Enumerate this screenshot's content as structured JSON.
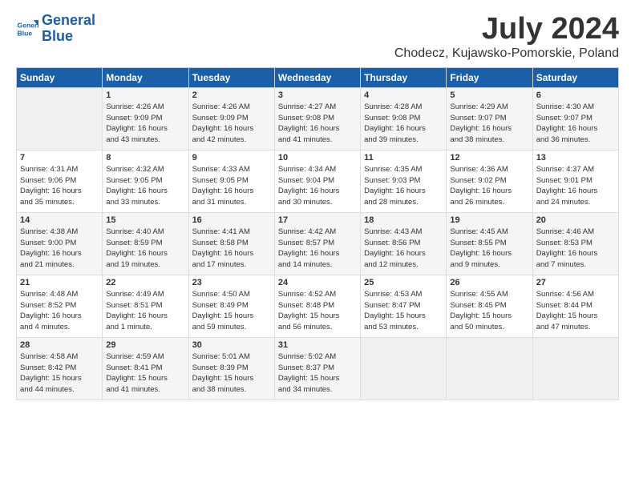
{
  "header": {
    "logo_line1": "General",
    "logo_line2": "Blue",
    "month": "July 2024",
    "location": "Chodecz, Kujawsko-Pomorskie, Poland"
  },
  "days_of_week": [
    "Sunday",
    "Monday",
    "Tuesday",
    "Wednesday",
    "Thursday",
    "Friday",
    "Saturday"
  ],
  "weeks": [
    [
      {
        "day": "",
        "data": ""
      },
      {
        "day": "1",
        "data": "Sunrise: 4:26 AM\nSunset: 9:09 PM\nDaylight: 16 hours\nand 43 minutes."
      },
      {
        "day": "2",
        "data": "Sunrise: 4:26 AM\nSunset: 9:09 PM\nDaylight: 16 hours\nand 42 minutes."
      },
      {
        "day": "3",
        "data": "Sunrise: 4:27 AM\nSunset: 9:08 PM\nDaylight: 16 hours\nand 41 minutes."
      },
      {
        "day": "4",
        "data": "Sunrise: 4:28 AM\nSunset: 9:08 PM\nDaylight: 16 hours\nand 39 minutes."
      },
      {
        "day": "5",
        "data": "Sunrise: 4:29 AM\nSunset: 9:07 PM\nDaylight: 16 hours\nand 38 minutes."
      },
      {
        "day": "6",
        "data": "Sunrise: 4:30 AM\nSunset: 9:07 PM\nDaylight: 16 hours\nand 36 minutes."
      }
    ],
    [
      {
        "day": "7",
        "data": "Sunrise: 4:31 AM\nSunset: 9:06 PM\nDaylight: 16 hours\nand 35 minutes."
      },
      {
        "day": "8",
        "data": "Sunrise: 4:32 AM\nSunset: 9:05 PM\nDaylight: 16 hours\nand 33 minutes."
      },
      {
        "day": "9",
        "data": "Sunrise: 4:33 AM\nSunset: 9:05 PM\nDaylight: 16 hours\nand 31 minutes."
      },
      {
        "day": "10",
        "data": "Sunrise: 4:34 AM\nSunset: 9:04 PM\nDaylight: 16 hours\nand 30 minutes."
      },
      {
        "day": "11",
        "data": "Sunrise: 4:35 AM\nSunset: 9:03 PM\nDaylight: 16 hours\nand 28 minutes."
      },
      {
        "day": "12",
        "data": "Sunrise: 4:36 AM\nSunset: 9:02 PM\nDaylight: 16 hours\nand 26 minutes."
      },
      {
        "day": "13",
        "data": "Sunrise: 4:37 AM\nSunset: 9:01 PM\nDaylight: 16 hours\nand 24 minutes."
      }
    ],
    [
      {
        "day": "14",
        "data": "Sunrise: 4:38 AM\nSunset: 9:00 PM\nDaylight: 16 hours\nand 21 minutes."
      },
      {
        "day": "15",
        "data": "Sunrise: 4:40 AM\nSunset: 8:59 PM\nDaylight: 16 hours\nand 19 minutes."
      },
      {
        "day": "16",
        "data": "Sunrise: 4:41 AM\nSunset: 8:58 PM\nDaylight: 16 hours\nand 17 minutes."
      },
      {
        "day": "17",
        "data": "Sunrise: 4:42 AM\nSunset: 8:57 PM\nDaylight: 16 hours\nand 14 minutes."
      },
      {
        "day": "18",
        "data": "Sunrise: 4:43 AM\nSunset: 8:56 PM\nDaylight: 16 hours\nand 12 minutes."
      },
      {
        "day": "19",
        "data": "Sunrise: 4:45 AM\nSunset: 8:55 PM\nDaylight: 16 hours\nand 9 minutes."
      },
      {
        "day": "20",
        "data": "Sunrise: 4:46 AM\nSunset: 8:53 PM\nDaylight: 16 hours\nand 7 minutes."
      }
    ],
    [
      {
        "day": "21",
        "data": "Sunrise: 4:48 AM\nSunset: 8:52 PM\nDaylight: 16 hours\nand 4 minutes."
      },
      {
        "day": "22",
        "data": "Sunrise: 4:49 AM\nSunset: 8:51 PM\nDaylight: 16 hours\nand 1 minute."
      },
      {
        "day": "23",
        "data": "Sunrise: 4:50 AM\nSunset: 8:49 PM\nDaylight: 15 hours\nand 59 minutes."
      },
      {
        "day": "24",
        "data": "Sunrise: 4:52 AM\nSunset: 8:48 PM\nDaylight: 15 hours\nand 56 minutes."
      },
      {
        "day": "25",
        "data": "Sunrise: 4:53 AM\nSunset: 8:47 PM\nDaylight: 15 hours\nand 53 minutes."
      },
      {
        "day": "26",
        "data": "Sunrise: 4:55 AM\nSunset: 8:45 PM\nDaylight: 15 hours\nand 50 minutes."
      },
      {
        "day": "27",
        "data": "Sunrise: 4:56 AM\nSunset: 8:44 PM\nDaylight: 15 hours\nand 47 minutes."
      }
    ],
    [
      {
        "day": "28",
        "data": "Sunrise: 4:58 AM\nSunset: 8:42 PM\nDaylight: 15 hours\nand 44 minutes."
      },
      {
        "day": "29",
        "data": "Sunrise: 4:59 AM\nSunset: 8:41 PM\nDaylight: 15 hours\nand 41 minutes."
      },
      {
        "day": "30",
        "data": "Sunrise: 5:01 AM\nSunset: 8:39 PM\nDaylight: 15 hours\nand 38 minutes."
      },
      {
        "day": "31",
        "data": "Sunrise: 5:02 AM\nSunset: 8:37 PM\nDaylight: 15 hours\nand 34 minutes."
      },
      {
        "day": "",
        "data": ""
      },
      {
        "day": "",
        "data": ""
      },
      {
        "day": "",
        "data": ""
      }
    ]
  ]
}
